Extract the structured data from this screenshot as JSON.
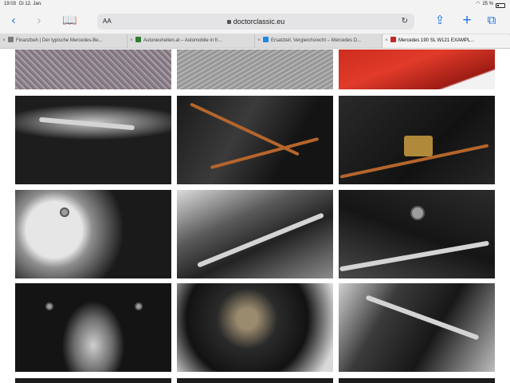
{
  "status_bar": {
    "time": "19:03",
    "date": "Di 12. Jan.",
    "battery": "25 %"
  },
  "toolbar": {
    "back_icon": "chevron-left-icon",
    "forward_icon": "chevron-right-icon",
    "bookmarks_icon": "book-icon",
    "text_size_label": "AA",
    "url": "doctorclassic.eu",
    "reload_icon": "reload-icon",
    "share_icon": "share-icon",
    "new_tab_icon": "plus-icon",
    "tabs_icon": "tabs-icon"
  },
  "tabs": [
    {
      "label": "Finanzbeh | Der typische Mercedes-Be...",
      "fav_color": "#7a7a7a",
      "active": false
    },
    {
      "label": "Autoneuheiten.at – Automobile in fr...",
      "fav_color": "#2e7d32",
      "active": false
    },
    {
      "label": "Ersatzteil, Vergleichsrecht – Mercedes D...",
      "fav_color": "#1e88e5",
      "active": false
    },
    {
      "label": "Mercedes 190 SL W121 EXAMPL...",
      "fav_color": "#c62828",
      "active": true
    }
  ],
  "gallery": {
    "photos": [
      {
        "name": "photo-carpet-floor"
      },
      {
        "name": "photo-floor-mat"
      },
      {
        "name": "photo-red-body-panel"
      },
      {
        "name": "photo-exhaust-pipe"
      },
      {
        "name": "photo-copper-brake-line"
      },
      {
        "name": "photo-brass-brake-distributor"
      },
      {
        "name": "photo-brake-booster"
      },
      {
        "name": "photo-chrome-linkage"
      },
      {
        "name": "photo-steering-linkage"
      },
      {
        "name": "photo-rear-subframe"
      },
      {
        "name": "photo-suspension-bolt"
      },
      {
        "name": "photo-control-arm"
      }
    ]
  }
}
